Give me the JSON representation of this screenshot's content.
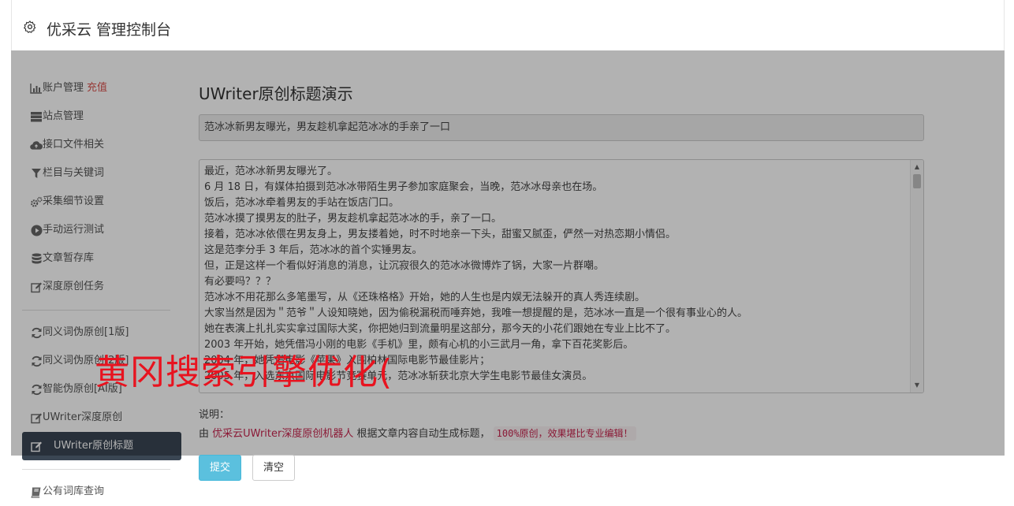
{
  "header": {
    "title": "优采云 管理控制台",
    "icon": "gear-icon"
  },
  "sidebar": {
    "items": [
      {
        "label": "账户管理",
        "badge": "充值",
        "icon": "bar-chart-icon"
      },
      {
        "label": "站点管理",
        "icon": "server-icon"
      },
      {
        "label": "接口文件相关",
        "icon": "cloud-upload-icon"
      },
      {
        "label": "栏目与关键词",
        "icon": "filter-icon"
      },
      {
        "label": "采集细节设置",
        "icon": "gears-icon"
      },
      {
        "label": "手动运行测试",
        "icon": "play-circle-icon"
      },
      {
        "label": "文章暂存库",
        "icon": "database-icon"
      },
      {
        "label": "深度原创任务",
        "icon": "edit-icon"
      }
    ],
    "items2": [
      {
        "label": "同义词伪原创[1版]",
        "icon": "refresh-icon"
      },
      {
        "label": "同义词伪原创[2版]",
        "icon": "refresh-icon"
      },
      {
        "label": "智能伪原创[AI版]",
        "icon": "refresh-icon"
      },
      {
        "label": "UWriter深度原创",
        "icon": "edit-icon"
      },
      {
        "label": "UWriter原创标题",
        "icon": "edit-icon",
        "active": true
      }
    ],
    "items3": [
      {
        "label": "公有词库查询",
        "icon": "book-icon"
      }
    ]
  },
  "main": {
    "title": "UWriter原创标题演示",
    "generated_title": "范冰冰新男友曝光，男友趁机拿起范冰冰的手亲了一口",
    "article_lines": [
      "最近，范冰冰新男友曝光了。",
      "6 月 18 日，有媒体拍摄到范冰冰带陌生男子参加家庭聚会，当晚，范冰冰母亲也在场。",
      "饭后，范冰冰牵着男友的手站在饭店门口。",
      "范冰冰摸了摸男友的肚子，男友趁机拿起范冰冰的手，亲了一口。",
      "接着，范冰冰依偎在男友身上，男友搂着她，时不时地亲一下头，甜蜜又腻歪，俨然一对热恋期小情侣。",
      "这是范李分手 3 年后，范冰冰的首个实锤男友。",
      "但，正是这样一个看似好消息的消息，让沉寂很久的范冰冰微博炸了锅，大家一片群嘲。",
      "有必要吗？？？",
      "范冰冰不用花那么多笔墨写，从《还珠格格》开始，她的人生也是内娱无法躲开的真人秀连续剧。",
      "大家当然是因为＂范爷＂人设知晓她，因为偷税漏税而唾弃她，我唯一想提醒的是，范冰冰一直是一个很有事业心的人。",
      "她在表演上扎扎实实拿过国际大奖，你把她归到流量明星这部分，那今天的小花们跟她在专业上比不了。",
      "2003 年开始，她凭借冯小刚的电影《手机》里，颇有心机的小三武月一角，拿下百花奖影后。",
      "2004 年，她凭借电影《苹果》入围柏林国际电影节最佳影片；",
      "2005 年，入选东京国际电影节竞赛单元，范冰冰斩获北京大学生电影节最佳女演员。"
    ],
    "note_label": "说明：",
    "note_prefix": "由",
    "note_link": "优采云UWriter深度原创机器人",
    "note_middle": "根据文章内容自动生成标题，",
    "note_code": "100%原创，效果堪比专业编辑！",
    "submit_label": "提交",
    "clear_label": "清空"
  },
  "watermark": "黄冈搜索引擎优化(",
  "colors": {
    "active_nav": "#3a4653",
    "submit": "#5bc0de",
    "recharge": "#d9534f",
    "watermark": "#e8131f"
  }
}
